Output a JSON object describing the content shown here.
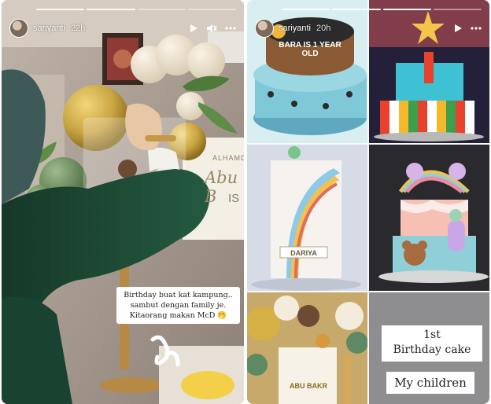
{
  "stories": {
    "left": {
      "username": "sariyanti",
      "time": "22h",
      "sign_text_1": "ALHAMD",
      "sign_text_2": "Abu B",
      "sign_text_3": "IS",
      "caption_lines": [
        "Birthday buat kat kampung..",
        "sambut dengan family je.",
        "Kitaorang makan McD 🤭"
      ]
    },
    "right": {
      "username": "sariyanti",
      "time": "20h",
      "cake1_text": "BARA IS 1 YEAR OLD",
      "cake3_name": "DARIYA",
      "cake5_text": "ABU BAKR",
      "label_cake": [
        "1st",
        "Birthday cake"
      ],
      "label_children": "My children"
    }
  },
  "icons": [
    "play-icon",
    "mute-icon",
    "more-icon"
  ],
  "colors": {
    "balloon_gold": "#c9a441",
    "balloon_green": "#5d7f53",
    "sweater_green": "#1f4a35",
    "cake_blue": "#7ec8d8"
  }
}
